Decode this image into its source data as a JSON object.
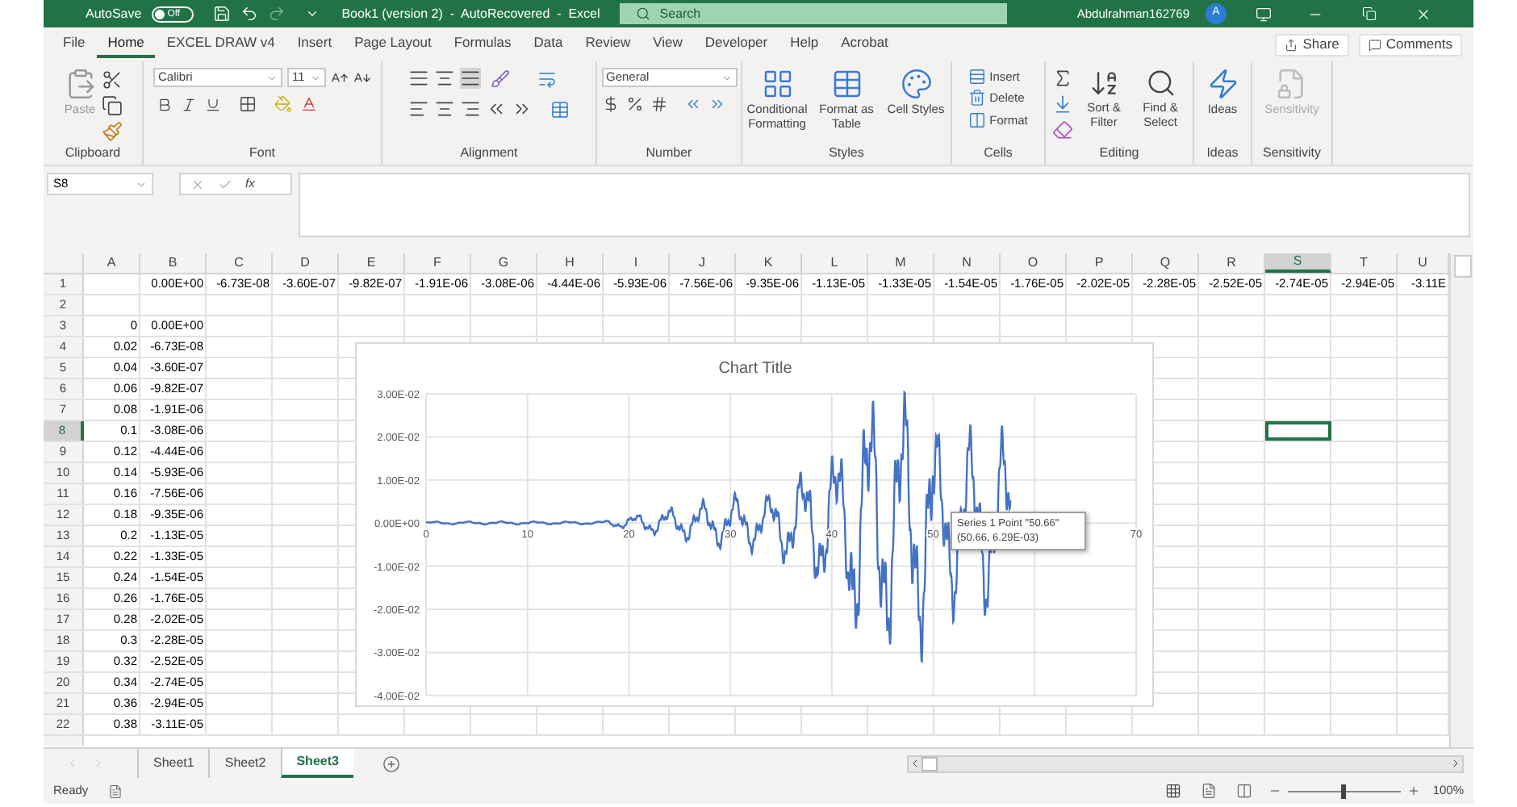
{
  "title_bar": {
    "autosave_label": "AutoSave",
    "autosave_toggle": {
      "label": "Off",
      "on": false
    },
    "title": "Book1 (version 2)  -  AutoRecovered  -  Excel",
    "search": {
      "placeholder": "Search"
    },
    "user": "Abdulrahman162769",
    "avatar": "A"
  },
  "menu_tabs": [
    {
      "label": "File",
      "selected": false
    },
    {
      "label": "Home",
      "selected": true
    },
    {
      "label": "EXCEL DRAW v4",
      "selected": false
    },
    {
      "label": "Insert",
      "selected": false
    },
    {
      "label": "Page Layout",
      "selected": false
    },
    {
      "label": "Formulas",
      "selected": false
    },
    {
      "label": "Data",
      "selected": false
    },
    {
      "label": "Review",
      "selected": false
    },
    {
      "label": "View",
      "selected": false
    },
    {
      "label": "Developer",
      "selected": false
    },
    {
      "label": "Help",
      "selected": false
    },
    {
      "label": "Acrobat",
      "selected": false
    }
  ],
  "share_button": "Share",
  "comments_button": "Comments",
  "ribbon": {
    "clipboard": {
      "paste": "Paste",
      "label": "Clipboard"
    },
    "font": {
      "name": "Calibri",
      "size": "11",
      "label": "Font"
    },
    "alignment": {
      "label": "Alignment"
    },
    "number": {
      "format": "General",
      "label": "Number"
    },
    "styles": {
      "buttons": [
        "Conditional Formatting",
        "Format as Table",
        "Cell Styles"
      ],
      "label": "Styles"
    },
    "cells": {
      "buttons": [
        "Insert",
        "Delete",
        "Format"
      ],
      "label": "Cells"
    },
    "editing": {
      "buttons": [
        "Sort & Filter",
        "Find & Select"
      ],
      "label": "Editing"
    },
    "ideas": {
      "button": "Ideas",
      "label": "Ideas"
    },
    "sensitivity": {
      "button": "Sensitivity",
      "label": "Sensitivity",
      "disabled": true
    }
  },
  "formula_bar": {
    "name_box": "S8",
    "function_label": "fx"
  },
  "columns": [
    {
      "label": "A",
      "selected": false
    },
    {
      "label": "B",
      "selected": false
    },
    {
      "label": "C",
      "selected": false
    },
    {
      "label": "D",
      "selected": false
    },
    {
      "label": "E",
      "selected": false
    },
    {
      "label": "F",
      "selected": false
    },
    {
      "label": "G",
      "selected": false
    },
    {
      "label": "H",
      "selected": false
    },
    {
      "label": "I",
      "selected": false
    },
    {
      "label": "J",
      "selected": false
    },
    {
      "label": "K",
      "selected": false
    },
    {
      "label": "L",
      "selected": false
    },
    {
      "label": "M",
      "selected": false
    },
    {
      "label": "N",
      "selected": false
    },
    {
      "label": "O",
      "selected": false
    },
    {
      "label": "P",
      "selected": false
    },
    {
      "label": "Q",
      "selected": false
    },
    {
      "label": "R",
      "selected": false
    },
    {
      "label": "S",
      "selected": true
    },
    {
      "label": "T",
      "selected": false
    },
    {
      "label": "U",
      "selected": false
    }
  ],
  "rows": [
    {
      "number": "1",
      "selected": false,
      "kind": "wide",
      "values": [
        "0.00E+00",
        "-6.73E-08",
        "-3.60E-07",
        "-9.82E-07",
        "-1.91E-06",
        "-3.08E-06",
        "-4.44E-06",
        "-5.93E-06",
        "-7.56E-06",
        "-9.35E-06",
        "-1.13E-05",
        "-1.33E-05",
        "-1.54E-05",
        "-1.76E-05",
        "-2.02E-05",
        "-2.28E-05",
        "-2.52E-05",
        "-2.74E-05",
        "-2.94E-05",
        "-3.11E"
      ]
    },
    {
      "number": "2",
      "selected": false,
      "kind": "blank"
    },
    {
      "number": "3",
      "selected": false,
      "kind": "pair",
      "values": [
        "0",
        "0.00E+00"
      ]
    },
    {
      "number": "4",
      "selected": false,
      "kind": "pair",
      "values": [
        "0.02",
        "-6.73E-08"
      ]
    },
    {
      "number": "5",
      "selected": false,
      "kind": "pair",
      "values": [
        "0.04",
        "-3.60E-07"
      ]
    },
    {
      "number": "6",
      "selected": false,
      "kind": "pair",
      "values": [
        "0.06",
        "-9.82E-07"
      ]
    },
    {
      "number": "7",
      "selected": false,
      "kind": "pair",
      "values": [
        "0.08",
        "-1.91E-06"
      ]
    },
    {
      "number": "8",
      "selected": true,
      "kind": "pair",
      "values": [
        "0.1",
        "-3.08E-06"
      ]
    },
    {
      "number": "9",
      "selected": false,
      "kind": "pair",
      "values": [
        "0.12",
        "-4.44E-06"
      ]
    },
    {
      "number": "10",
      "selected": false,
      "kind": "pair",
      "values": [
        "0.14",
        "-5.93E-06"
      ]
    },
    {
      "number": "11",
      "selected": false,
      "kind": "pair",
      "values": [
        "0.16",
        "-7.56E-06"
      ]
    },
    {
      "number": "12",
      "selected": false,
      "kind": "pair",
      "values": [
        "0.18",
        "-9.35E-06"
      ]
    },
    {
      "number": "13",
      "selected": false,
      "kind": "pair",
      "values": [
        "0.2",
        "-1.13E-05"
      ]
    },
    {
      "number": "14",
      "selected": false,
      "kind": "pair",
      "values": [
        "0.22",
        "-1.33E-05"
      ]
    },
    {
      "number": "15",
      "selected": false,
      "kind": "pair",
      "values": [
        "0.24",
        "-1.54E-05"
      ]
    },
    {
      "number": "16",
      "selected": false,
      "kind": "pair",
      "values": [
        "0.26",
        "-1.76E-05"
      ]
    },
    {
      "number": "17",
      "selected": false,
      "kind": "pair",
      "values": [
        "0.28",
        "-2.02E-05"
      ]
    },
    {
      "number": "18",
      "selected": false,
      "kind": "pair",
      "values": [
        "0.3",
        "-2.28E-05"
      ]
    },
    {
      "number": "19",
      "selected": false,
      "kind": "pair",
      "values": [
        "0.32",
        "-2.52E-05"
      ]
    },
    {
      "number": "20",
      "selected": false,
      "kind": "pair",
      "values": [
        "0.34",
        "-2.74E-05"
      ]
    },
    {
      "number": "21",
      "selected": false,
      "kind": "pair",
      "values": [
        "0.36",
        "-2.94E-05"
      ]
    },
    {
      "number": "22",
      "selected": false,
      "kind": "pair",
      "values": [
        "0.38",
        "-3.11E-05"
      ]
    }
  ],
  "chart": {
    "title": "Chart Title",
    "yticks": [
      "3.00E-02",
      "2.00E-02",
      "1.00E-02",
      "0.00E+00",
      "-1.00E-02",
      "-2.00E-02",
      "-3.00E-02",
      "-4.00E-02"
    ],
    "xticks": [
      "0",
      "10",
      "20",
      "30",
      "40",
      "50",
      "70"
    ],
    "tooltip": [
      "Series 1 Point \"50.66\"",
      "(50.66, 6.29E-03)"
    ]
  },
  "sheet_tabs": [
    {
      "label": "Sheet1",
      "selected": false
    },
    {
      "label": "Sheet2",
      "selected": false
    },
    {
      "label": "Sheet3",
      "selected": true
    }
  ],
  "status_bar": {
    "status": "Ready",
    "zoom": "100%",
    "zoom_slider": {
      "level": 0.5
    }
  }
}
